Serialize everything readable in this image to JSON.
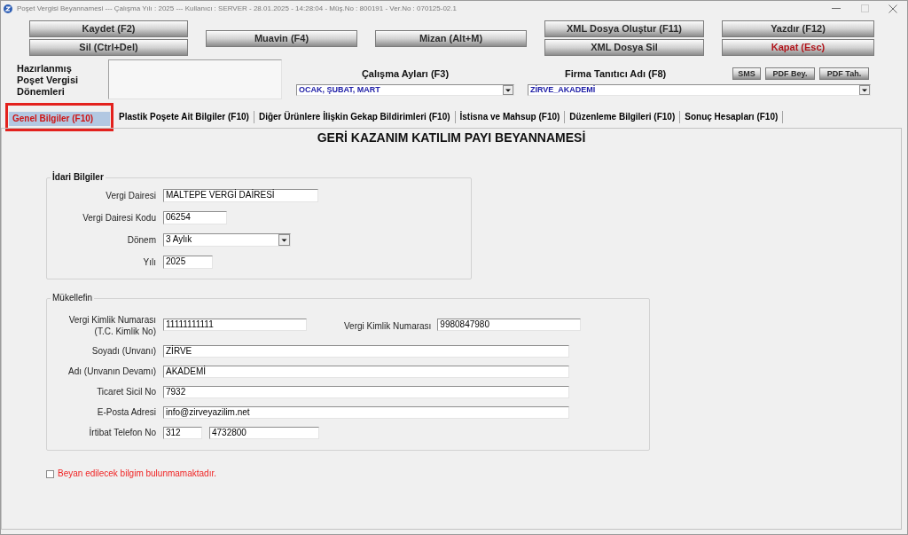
{
  "window": {
    "title": "Poşet Vergisi Beyannamesi --- Çalışma Yılı : 2025 --- Kullanıcı : SERVER - 28.01.2025 - 14:28:04 - Müş.No : 800191 - Ver.No : 070125-02.1",
    "controls": [
      {
        "kind": "minimize",
        "disabled": false
      },
      {
        "kind": "maximize",
        "disabled": true
      },
      {
        "kind": "close",
        "disabled": false
      }
    ]
  },
  "toolbar": {
    "columns": [
      {
        "buttons": [
          {
            "label": "Kaydet (F2)",
            "kind": "normal"
          },
          {
            "label": "Sil (Ctrl+Del)",
            "kind": "normal"
          }
        ]
      },
      {
        "buttons": [
          {
            "label": "Muavin (F4)",
            "kind": "normal"
          }
        ]
      },
      {
        "buttons": [
          {
            "label": "Mizan (Alt+M)",
            "kind": "normal"
          }
        ]
      },
      {
        "buttons": [
          {
            "label": "XML Dosya Oluştur (F11)",
            "kind": "normal"
          },
          {
            "label": "XML Dosya Sil",
            "kind": "normal"
          }
        ]
      },
      {
        "buttons": [
          {
            "label": "Yazdır (F12)",
            "kind": "normal"
          },
          {
            "label": "Kapat (Esc)",
            "kind": "danger"
          }
        ]
      }
    ]
  },
  "prepared_periods": {
    "label_lines": [
      "Hazırlanmış",
      "Poşet Vergisi",
      "Dönemleri"
    ]
  },
  "work_months": {
    "label": "Çalışma Ayları (F3)",
    "value": "OCAK, ŞUBAT, MART"
  },
  "company": {
    "label": "Firma Tanıtıcı Adı (F8)",
    "value": "ZİRVE_AKADEMİ",
    "buttons": [
      {
        "label": "SMS"
      },
      {
        "label": "PDF Bey."
      },
      {
        "label": "PDF Tah."
      }
    ]
  },
  "tabs": [
    {
      "label": "Genel Bilgiler (F10)",
      "selected": true,
      "highlighted": true
    },
    {
      "label": "Plastik Poşete Ait Bilgiler (F10)",
      "selected": false,
      "highlighted": false
    },
    {
      "label": "Diğer Ürünlere İlişkin Gekap Bildirimleri (F10)",
      "selected": false,
      "highlighted": false
    },
    {
      "label": "İstisna ve Mahsup (F10)",
      "selected": false,
      "highlighted": false
    },
    {
      "label": "Düzenleme Bilgileri (F10)",
      "selected": false,
      "highlighted": false
    },
    {
      "label": "Sonuç Hesapları (F10)",
      "selected": false,
      "highlighted": false
    }
  ],
  "form_title": "GERİ KAZANIM KATILIM PAYI BEYANNAMESİ",
  "administrative": {
    "legend": "İdari Bilgiler",
    "fields": [
      {
        "label": "Vergi Dairesi",
        "value": "MALTEPE VERGİ DAİRESİ",
        "kind": "text"
      },
      {
        "label": "Vergi Dairesi Kodu",
        "value": "06254",
        "kind": "text"
      },
      {
        "label": "Dönem",
        "value": "3 Aylık",
        "kind": "select"
      },
      {
        "label": "Yılı",
        "value": "2025",
        "kind": "text"
      }
    ]
  },
  "taxpayer": {
    "legend": "Mükellefin",
    "tc_label_lines": [
      "Vergi Kimlik Numarası",
      "(T.C. Kimlik No)"
    ],
    "tc_value": "11111111111",
    "vkn_label": "Vergi Kimlik Numarası",
    "vkn_value": "9980847980",
    "fields": [
      {
        "label": "Soyadı (Unvanı)",
        "value": "ZİRVE"
      },
      {
        "label": "Adı (Unvanın Devamı)",
        "value": "AKADEMİ"
      },
      {
        "label": "Ticaret Sicil No",
        "value": "7932"
      },
      {
        "label": "E-Posta Adresi",
        "value": "info@zirveyazilim.net"
      }
    ],
    "phone": {
      "label": "İrtibat Telefon No",
      "area_code": "312",
      "number": "4732800"
    }
  },
  "no_declaration": {
    "label": "Beyan edilecek bilgim bulunmamaktadır.",
    "checked": false
  }
}
